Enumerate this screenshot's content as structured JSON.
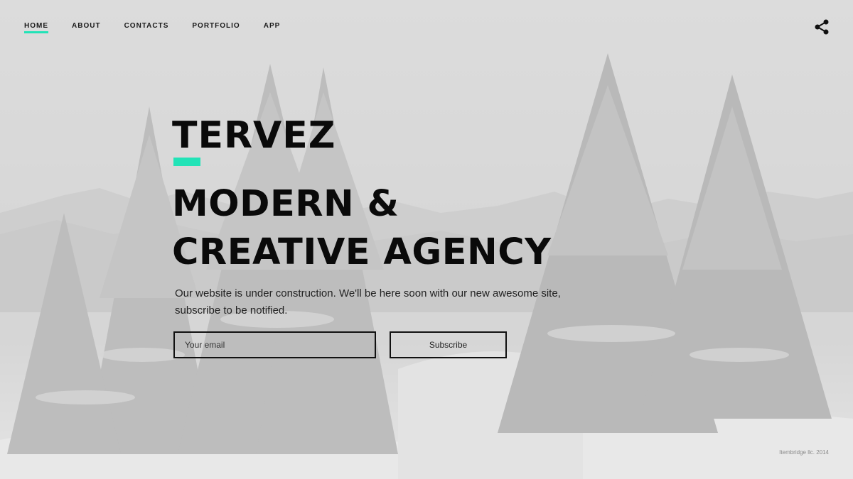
{
  "nav": {
    "items": [
      {
        "label": "HOME",
        "active": true
      },
      {
        "label": "ABOUT",
        "active": false
      },
      {
        "label": "CONTACTS",
        "active": false
      },
      {
        "label": "PORTFOLIO",
        "active": false
      },
      {
        "label": "APP",
        "active": false
      }
    ],
    "share_icon": "share-icon"
  },
  "hero": {
    "brand": "TERVEZ",
    "headline_line1": "MODERN &",
    "headline_line2": "CREATIVE AGENCY",
    "description": "Our website is under construction. We'll be here soon with our new awesome site, subscribe to be notified."
  },
  "subscribe_form": {
    "email_placeholder": "Your email",
    "button_label": "Subscribe"
  },
  "footer": {
    "copyright": "Itembridge llc. 2014"
  },
  "colors": {
    "accent": "#22e3b7",
    "text": "#0a0a0a",
    "background": "#d6d6d6"
  }
}
